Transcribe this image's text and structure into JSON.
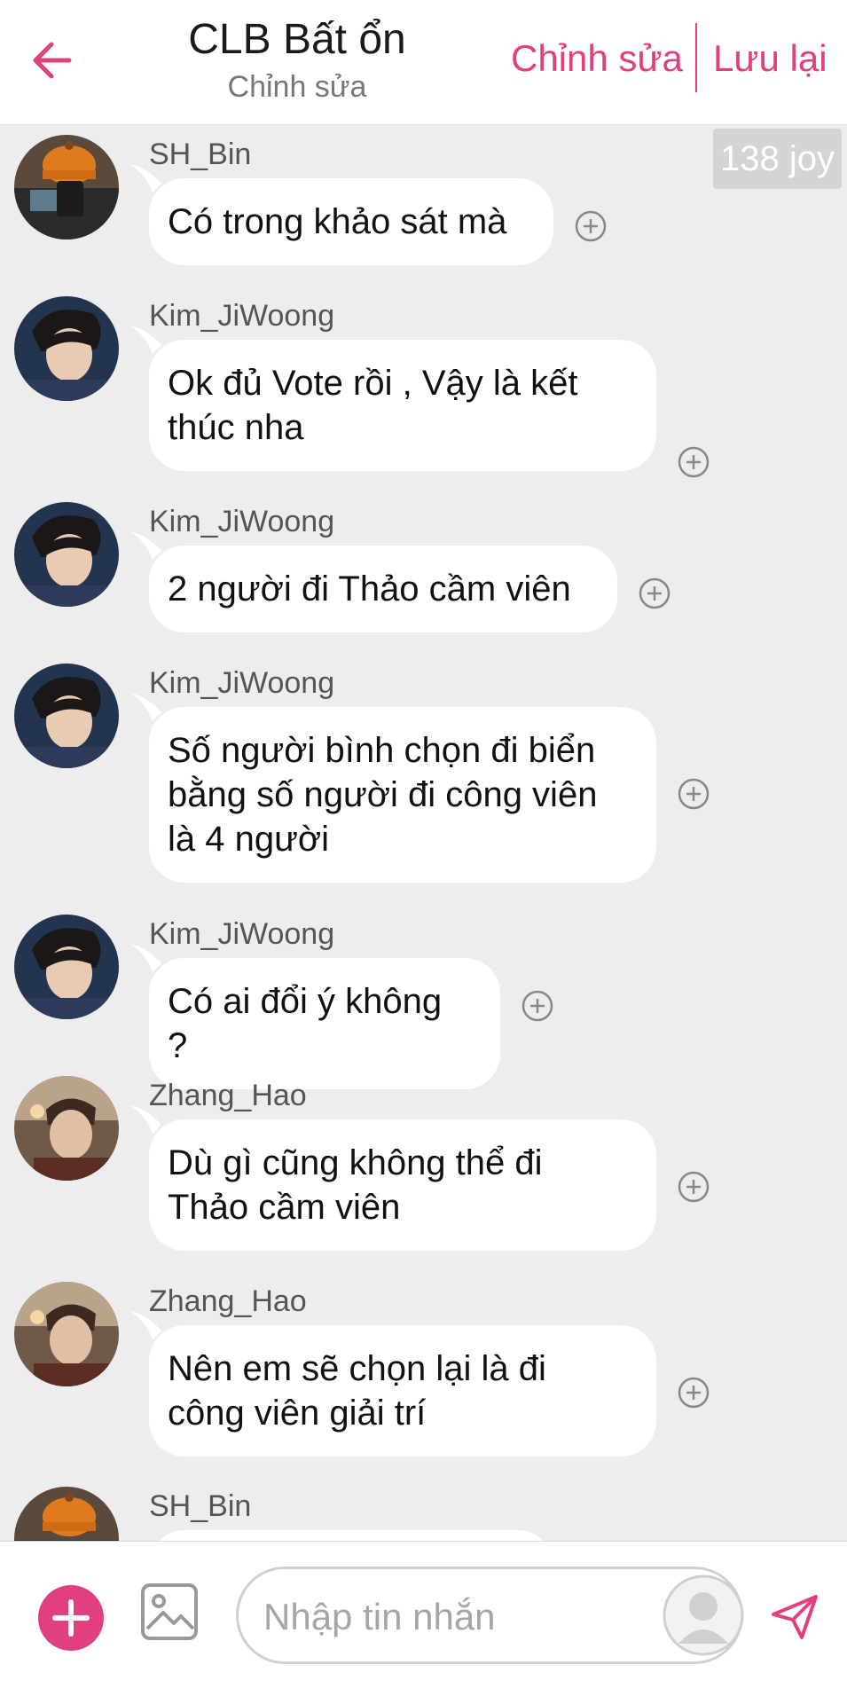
{
  "header": {
    "title": "CLB Bất ổn",
    "subtitle": "Chỉnh sửa",
    "edit_label": "Chỉnh sửa",
    "save_label": "Lưu lại"
  },
  "joy_badge": "138 joy",
  "messages": [
    {
      "sender": "SH_Bin",
      "text": "Có trong khảo sát mà"
    },
    {
      "sender": "Kim_JiWoong",
      "text": "Ok đủ Vote rồi , Vậy là kết thúc nha"
    },
    {
      "sender": "Kim_JiWoong",
      "text": "2 người đi Thảo cầm viên"
    },
    {
      "sender": "Kim_JiWoong",
      "text": "Số người bình chọn đi biển bằng số người đi công viên là 4 người"
    },
    {
      "sender": "Kim_JiWoong",
      "text": "Có ai đổi ý không ?"
    },
    {
      "sender": "Zhang_Hao",
      "text": "Dù gì cũng không thể đi Thảo cầm viên"
    },
    {
      "sender": "Zhang_Hao",
      "text": "Nên em sẽ chọn lại là đi công viên giải trí"
    },
    {
      "sender": "SH_Bin",
      "text": ""
    }
  ],
  "composer": {
    "placeholder": "Nhập tin nhắn"
  },
  "colors": {
    "accent": "#e0407e",
    "chat_background": "#ededed",
    "bubble": "#ffffff"
  },
  "icons": [
    "back-arrow-icon",
    "add-reaction-icon",
    "plus-icon",
    "image-icon",
    "sticker-avatar-icon",
    "send-icon"
  ]
}
